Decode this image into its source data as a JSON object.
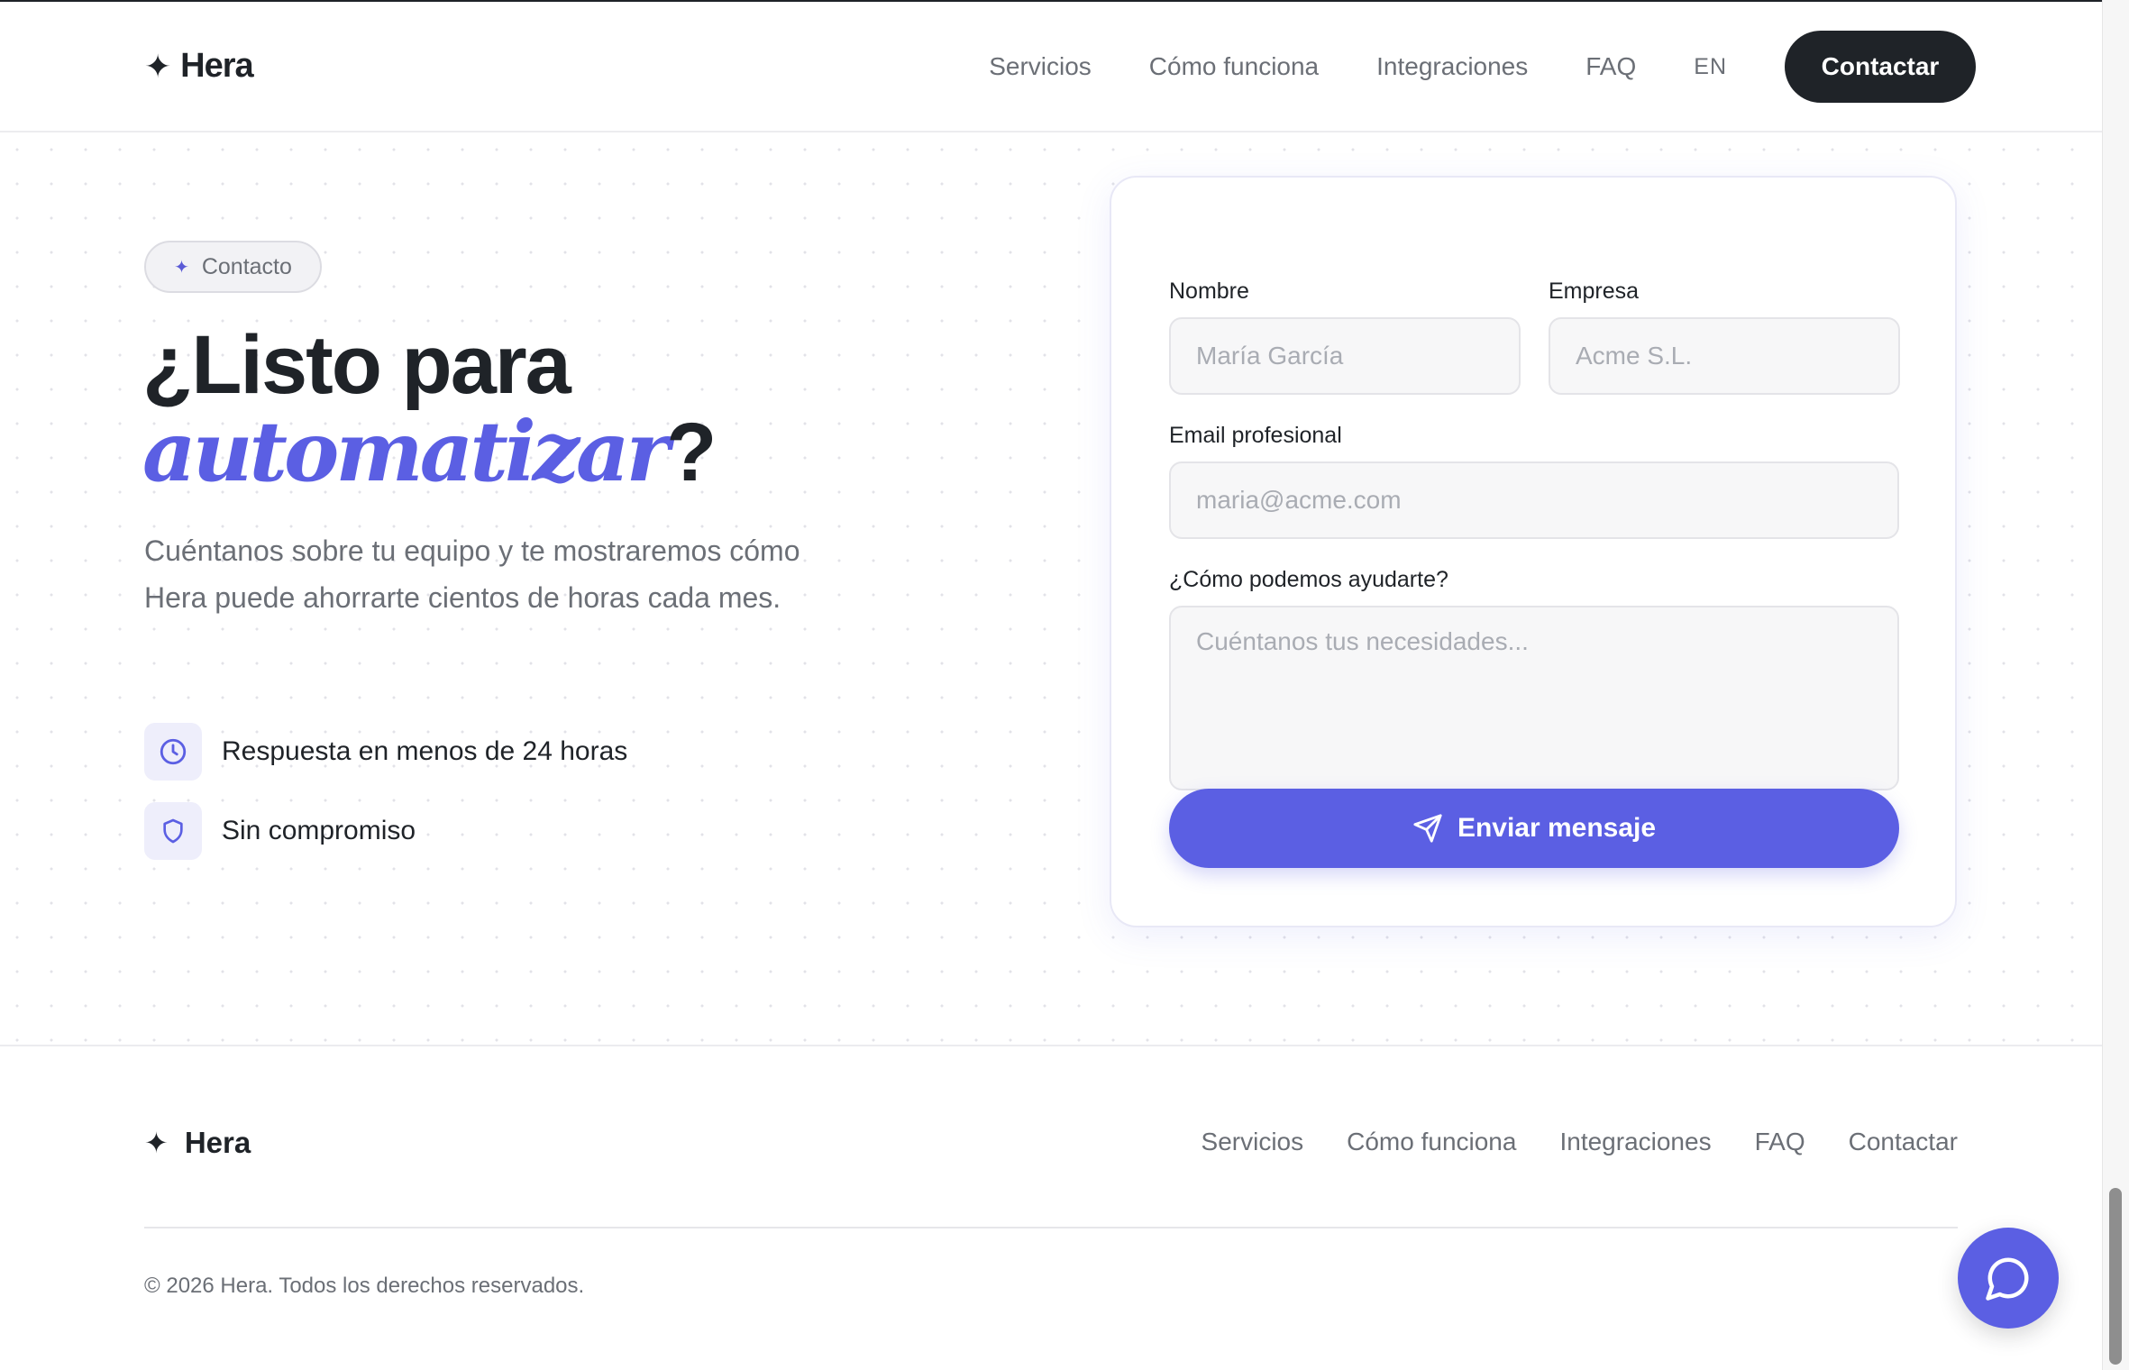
{
  "header": {
    "brand": "Hera",
    "nav": [
      "Servicios",
      "Cómo funciona",
      "Integraciones",
      "FAQ"
    ],
    "lang": "EN",
    "cta_label": "Contactar"
  },
  "hero": {
    "badge": "Contacto",
    "title_line1": "¿Listo para",
    "title_accent": "automatizar",
    "title_suffix": "?",
    "lead": "Cuéntanos sobre tu equipo y te mostraremos cómo Hera puede ahorrarte cientos de horas cada mes.",
    "features": [
      {
        "icon": "clock-icon",
        "label": "Respuesta en menos de 24 horas"
      },
      {
        "icon": "shield-icon",
        "label": "Sin compromiso"
      }
    ]
  },
  "form": {
    "name_label": "Nombre",
    "name_placeholder": "María García",
    "company_label": "Empresa",
    "company_placeholder": "Acme S.L.",
    "email_label": "Email profesional",
    "email_placeholder": "maria@acme.com",
    "message_label": "¿Cómo podemos ayudarte?",
    "message_placeholder": "Cuéntanos tus necesidades...",
    "submit_label": "Enviar mensaje"
  },
  "footer": {
    "brand": "Hera",
    "nav": [
      "Servicios",
      "Cómo funciona",
      "Integraciones",
      "FAQ",
      "Contactar"
    ],
    "copyright": "© 2026 Hera. Todos los derechos reservados."
  },
  "colors": {
    "accent": "#5b5fe3",
    "dark": "#1f2328",
    "muted": "#6b6f76"
  }
}
